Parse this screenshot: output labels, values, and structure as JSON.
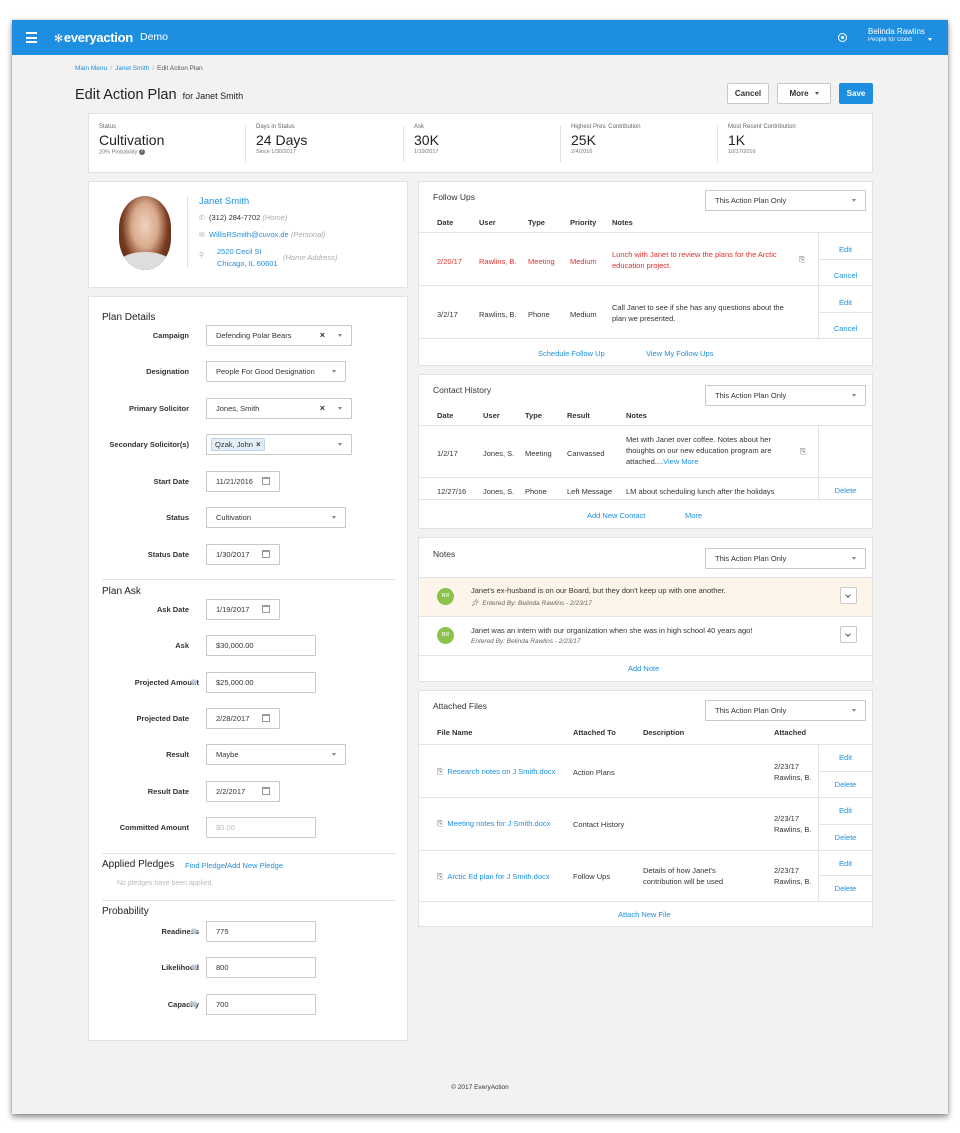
{
  "app": {
    "brand": "everyaction",
    "env": "Demo"
  },
  "user": {
    "name": "Belinda Rawlins",
    "org": "People for Good"
  },
  "breadcrumb": {
    "main": "Main Menu",
    "contact": "Janet Smith",
    "current": "Edit Action Plan"
  },
  "page": {
    "title": "Edit Action Plan",
    "for": "for Janet Smith"
  },
  "actions": {
    "cancel": "Cancel",
    "more": "More",
    "save": "Save"
  },
  "stats": [
    {
      "label": "Status",
      "value": "Cultivation",
      "sub": "20% Probability"
    },
    {
      "label": "Days in Status",
      "value": "24 Days",
      "sub": "Since 1/30/2017"
    },
    {
      "label": "Ask",
      "value": "30K",
      "sub": "1/19/2017"
    },
    {
      "label": "Highest Prev. Contribution",
      "value": "25K",
      "sub": "2/4/2016"
    },
    {
      "label": "Most Recent Contribution",
      "value": "1K",
      "sub": "10/17/2016"
    }
  ],
  "contact": {
    "name": "Janet Smith",
    "phone": "(312) 284-7702",
    "phone_type": "(Home)",
    "email": "WillisRSmith@cuvox.de",
    "email_type": "(Personal)",
    "addr1": "2520 Cecil St",
    "addr2": "Chicago, IL 60601",
    "addr_type": "(Home Address)"
  },
  "plan_details": {
    "title": "Plan Details",
    "campaign_label": "Campaign",
    "campaign": "Defending Polar Bears",
    "designation_label": "Designation",
    "designation": "People For Good Designation",
    "primary_label": "Primary Solicitor",
    "primary": "Jones, Smith",
    "secondary_label": "Secondary Solicitor(s)",
    "secondary": "Qzak, John",
    "start_label": "Start Date",
    "start": "11/21/2016",
    "status_label": "Status",
    "status": "Cultivation",
    "status_date_label": "Status Date",
    "status_date": "1/30/2017"
  },
  "plan_ask": {
    "title": "Plan Ask",
    "ask_date_label": "Ask Date",
    "ask_date": "1/19/2017",
    "ask_label": "Ask",
    "ask": "$30,000.00",
    "projected_amount_label": "Projected Amount",
    "projected_amount": "$25,000.00",
    "projected_date_label": "Projected Date",
    "projected_date": "2/28/2017",
    "result_label": "Result",
    "result": "Maybe",
    "result_date_label": "Result Date",
    "result_date": "2/2/2017",
    "committed_label": "Committed Amount",
    "committed_placeholder": "$0.00"
  },
  "pledges": {
    "title": "Applied Pledges",
    "find": "Find Pledge",
    "slash": "/",
    "add": "Add New Pledge",
    "empty": "No pledges have been applied."
  },
  "probability": {
    "title": "Probability",
    "readiness_label": "Readiness",
    "readiness": "775",
    "likelihood_label": "Likelihood",
    "likelihood": "800",
    "capacity_label": "Capacity",
    "capacity": "700"
  },
  "followups": {
    "title": "Follow Ups",
    "filter": "This Action Plan Only",
    "headers": [
      "Date",
      "User",
      "Type",
      "Priority",
      "Notes"
    ],
    "rows": [
      {
        "date": "2/20/17",
        "user": "Rawlins, B.",
        "type": "Meeting",
        "priority": "Medium",
        "notes": "Lunch with Janet to review the plans for the Arctic education project.",
        "edit": "Edit",
        "cancel": "Cancel"
      },
      {
        "date": "3/2/17",
        "user": "Rawlins, B.",
        "type": "Phone",
        "priority": "Medium",
        "notes": "Call Janet to see if she has any questions about the plan we presented.",
        "edit": "Edit",
        "cancel": "Cancel"
      }
    ],
    "schedule": "Schedule Follow Up",
    "view": "View My Follow Ups"
  },
  "history": {
    "title": "Contact History",
    "filter": "This Action Plan Only",
    "headers": [
      "Date",
      "User",
      "Type",
      "Result",
      "Notes"
    ],
    "rows": [
      {
        "date": "1/2/17",
        "user": "Jones, S.",
        "type": "Meeting",
        "result": "Canvassed",
        "notes": "Met with Janet over coffee. Notes about her thoughts on our new education program are attached....",
        "more": "View More"
      },
      {
        "date": "12/27/16",
        "user": "Jones, S.",
        "type": "Phone",
        "result": "Left Message",
        "notes": "LM about scheduling lunch after the holidays",
        "delete": "Delete"
      }
    ],
    "add": "Add New Contact",
    "more": "More"
  },
  "notes": {
    "title": "Notes",
    "filter": "This Action Plan Only",
    "items": [
      {
        "initials": "BR",
        "text": "Janet's ex-husband is on our Board, but they don't keep up with one another.",
        "meta": "Entered By:  Belinda  Rawlins  - 2/23/17"
      },
      {
        "initials": "BR",
        "text": "Janet was an intern with our organization when she was in high school 40 years ago!",
        "meta": "Entered By:  Belinda  Rawlins  - 2/23/17"
      }
    ],
    "add": "Add Note"
  },
  "files": {
    "title": "Attached Files",
    "filter": "This Action Plan Only",
    "headers": [
      "File Name",
      "Attached To",
      "Description",
      "Attached"
    ],
    "rows": [
      {
        "name": "Research notes on J Smith.docx",
        "to": "Action Plans",
        "desc": "",
        "date": "2/23/17",
        "by": "Rawlins, B.",
        "edit": "Edit",
        "delete": "Delete"
      },
      {
        "name": "Meeting notes for J Smith.docx",
        "to": "Contact History",
        "desc": "",
        "date": "2/23/17",
        "by": "Rawlins, B.",
        "edit": "Edit",
        "delete": "Delete"
      },
      {
        "name": "Arctic Ed plan for J Smith.docx",
        "to": "Follow Ups",
        "desc": "Details of how Janet's contribution will be used",
        "date": "2/23/17",
        "by": "Rawlins, B.",
        "edit": "Edit",
        "delete": "Delete"
      }
    ],
    "attach": "Attach New File"
  },
  "footer": {
    "copyright": "© 2017 EveryAction"
  },
  "colors": {
    "brand": "#1e8fe0",
    "danger": "#e0312f",
    "note_highlight": "#fdf5e9",
    "avatar_bubble": "#8bc34a"
  }
}
